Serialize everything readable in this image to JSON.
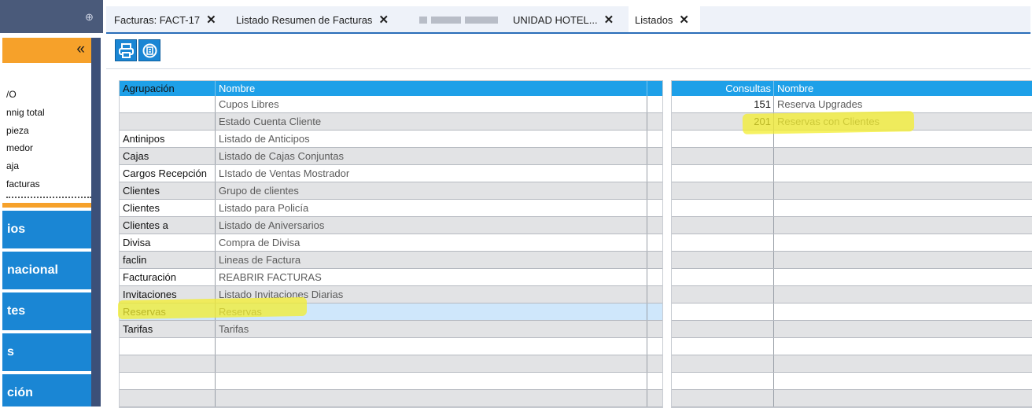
{
  "left_nav": {
    "collapse_glyph": "«",
    "pin_glyph": "⊕",
    "items": [
      "/O",
      "nnig total",
      "pieza",
      "medor",
      "aja",
      "facturas"
    ],
    "big_buttons": [
      "ios",
      "nacional",
      "tes",
      "s",
      "ción"
    ]
  },
  "tabs": [
    {
      "label": "Facturas: FACT-17",
      "close": "✕"
    },
    {
      "label": "Listado Resumen de Facturas",
      "close": "✕"
    },
    {
      "label": "UNIDAD HOTEL...",
      "close": "✕"
    },
    {
      "label": "Listados",
      "close": "✕",
      "active": true
    }
  ],
  "toolbar": {
    "icons": [
      "print-icon",
      "export-icon"
    ]
  },
  "left_grid": {
    "columns": [
      "Agrupación",
      "Nombre"
    ],
    "rows": [
      {
        "agrupacion": "",
        "nombre": "Cupos Libres"
      },
      {
        "agrupacion": "",
        "nombre": "Estado Cuenta Cliente"
      },
      {
        "agrupacion": "Antinipos",
        "nombre": "Listado de Anticipos"
      },
      {
        "agrupacion": "Cajas",
        "nombre": "Listado de Cajas Conjuntas"
      },
      {
        "agrupacion": "Cargos Recepción",
        "nombre": "LIstado de Ventas Mostrador"
      },
      {
        "agrupacion": "Clientes",
        "nombre": "Grupo de clientes"
      },
      {
        "agrupacion": "Clientes",
        "nombre": "Listado para Policía"
      },
      {
        "agrupacion": "Clientes a",
        "nombre": "Listado de Aniversarios"
      },
      {
        "agrupacion": "Divisa",
        "nombre": "Compra de Divisa"
      },
      {
        "agrupacion": "faclin",
        "nombre": "Lineas de Factura"
      },
      {
        "agrupacion": "Facturación",
        "nombre": "REABRIR FACTURAS"
      },
      {
        "agrupacion": "Invitaciones",
        "nombre": "Listado Invitaciones Diarias"
      },
      {
        "agrupacion": "Reservas",
        "nombre": "Reservas"
      },
      {
        "agrupacion": "Tarifas",
        "nombre": "Tarifas"
      },
      {
        "agrupacion": "",
        "nombre": ""
      },
      {
        "agrupacion": "",
        "nombre": ""
      },
      {
        "agrupacion": "",
        "nombre": ""
      },
      {
        "agrupacion": "",
        "nombre": ""
      },
      {
        "agrupacion": "",
        "nombre": ""
      }
    ]
  },
  "right_grid": {
    "columns": [
      "Consultas",
      "Nombre"
    ],
    "rows": [
      {
        "consultas": "151",
        "nombre": "Reserva Upgrades"
      },
      {
        "consultas": "201",
        "nombre": "Reservas con Clientes"
      },
      {
        "consultas": "",
        "nombre": ""
      },
      {
        "consultas": "",
        "nombre": ""
      },
      {
        "consultas": "",
        "nombre": ""
      },
      {
        "consultas": "",
        "nombre": ""
      },
      {
        "consultas": "",
        "nombre": ""
      },
      {
        "consultas": "",
        "nombre": ""
      },
      {
        "consultas": "",
        "nombre": ""
      },
      {
        "consultas": "",
        "nombre": ""
      },
      {
        "consultas": "",
        "nombre": ""
      },
      {
        "consultas": "",
        "nombre": ""
      },
      {
        "consultas": "",
        "nombre": ""
      },
      {
        "consultas": "",
        "nombre": ""
      },
      {
        "consultas": "",
        "nombre": ""
      },
      {
        "consultas": "",
        "nombre": ""
      },
      {
        "consultas": "",
        "nombre": ""
      },
      {
        "consultas": "",
        "nombre": ""
      },
      {
        "consultas": "",
        "nombre": ""
      }
    ]
  },
  "colors": {
    "header_blue": "#1ea0e8",
    "nav_blue": "#1a86d4",
    "nav_orange": "#f6a12a",
    "highlight_yellow": "#f3ee2d",
    "selected_row": "#cfe7fb"
  }
}
